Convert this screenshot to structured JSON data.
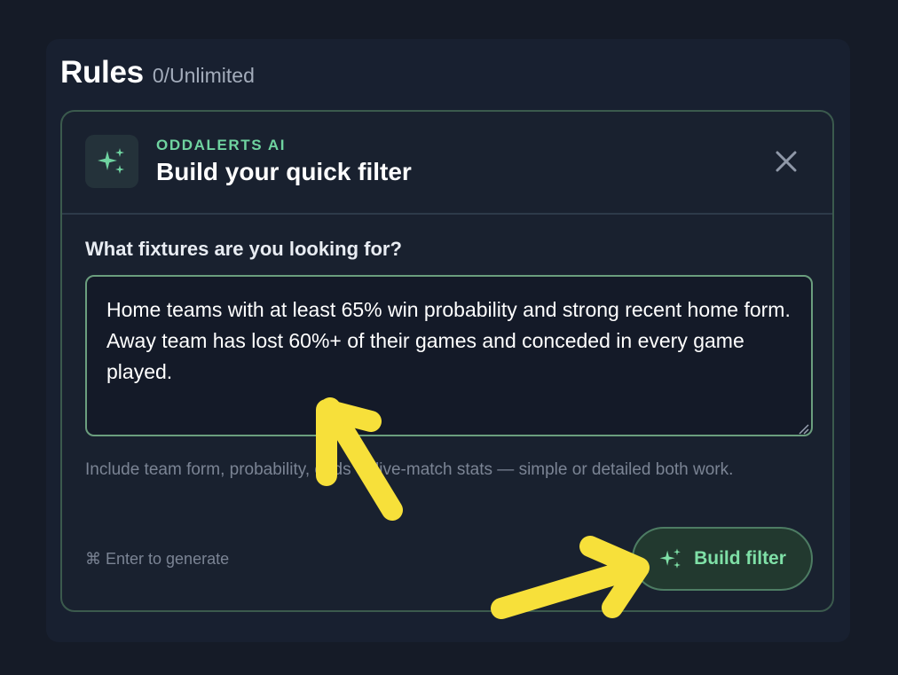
{
  "rules": {
    "title": "Rules",
    "count": "0/Unlimited"
  },
  "card": {
    "brand": "ODDALERTS AI",
    "title": "Build your quick filter",
    "close_icon": "close-icon",
    "badge_icon": "sparkles-icon"
  },
  "form": {
    "question": "What fixtures are you looking for?",
    "query_value": "Home teams with at least 65% win probability and strong recent home form. Away team has lost 60%+ of their games and conceded in every game played.",
    "hint": "Include team form, probability, odds or live-match stats — simple or detailed both work.",
    "shortcut": "⌘ Enter to generate",
    "build_label": "Build filter"
  },
  "colors": {
    "accent_green": "#6fd3a0",
    "card_border": "#3b5a4d",
    "annotation_arrow": "#f7e03a",
    "background": "#151b27"
  }
}
